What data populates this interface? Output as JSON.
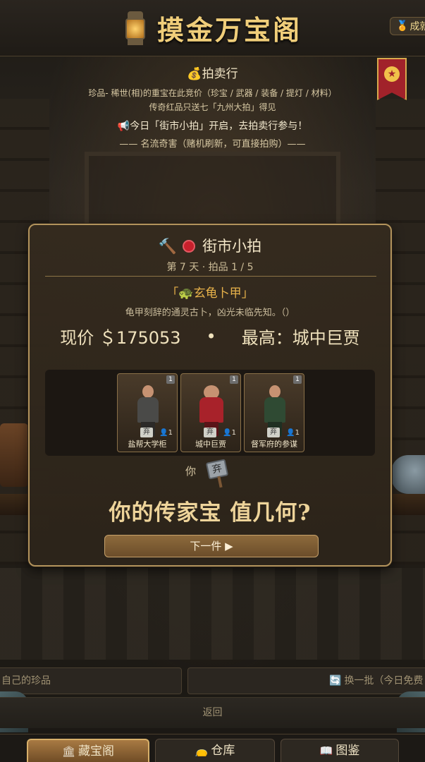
{
  "header": {
    "title": "摸金万宝阁",
    "achievement_label": "成就"
  },
  "auction_house": {
    "heading": "拍卖行",
    "line1": "珍品- 稀世(相)的重宝在此竞价（珍宝 / 武器 / 装备 / 提灯 / 材料）",
    "line2": "传奇红品只送七「九州大拍」得见",
    "announcement": "今日「街市小拍」开启，去拍卖行参与！",
    "collector_line": "—— 名流奇害（赌机刷新，可直接拍购）——"
  },
  "panel": {
    "title": "街市小拍",
    "subtitle": "第 7 天 · 拍品 1 / 5",
    "item_name_left": "「",
    "item_name": "玄龟卜甲",
    "item_name_right": "」",
    "item_desc": "龟甲刻辞的通灵古卜，凶光未临先知。（）",
    "price_label": "现价 ＄175053",
    "separator": "•",
    "top_bidder_label": "最高：城中巨贾",
    "bidders": [
      {
        "name": "盐帮大学柜",
        "count": "1",
        "badge": "1",
        "tag": "弃",
        "torso_color": "#4a4a48"
      },
      {
        "name": "城中巨贾",
        "count": "1",
        "badge": "1",
        "tag": "弃",
        "torso_color": "#a8222a"
      },
      {
        "name": "督军府的参谋",
        "count": "1",
        "badge": "1",
        "tag": "弃",
        "torso_color": "#2f4a33"
      }
    ],
    "you_label": "你",
    "you_sign": "弃",
    "slogan": "你的传家宝 值几何?",
    "next_button": "下一件 ▶"
  },
  "bottom": {
    "my_treasures_placeholder": "自己的珍品",
    "refresh_label": "换一批（今日免费",
    "back_label": "返回"
  },
  "tabs": [
    {
      "label": "藏宝阁",
      "icon": "temple-icon",
      "active": true
    },
    {
      "label": "仓库",
      "icon": "bag-icon",
      "active": false
    },
    {
      "label": "图鉴",
      "icon": "book-icon",
      "active": false
    }
  ],
  "colors": {
    "accent_gold": "#f0ce7a",
    "panel_border": "#b2935c",
    "item_name": "#e6b14a"
  }
}
